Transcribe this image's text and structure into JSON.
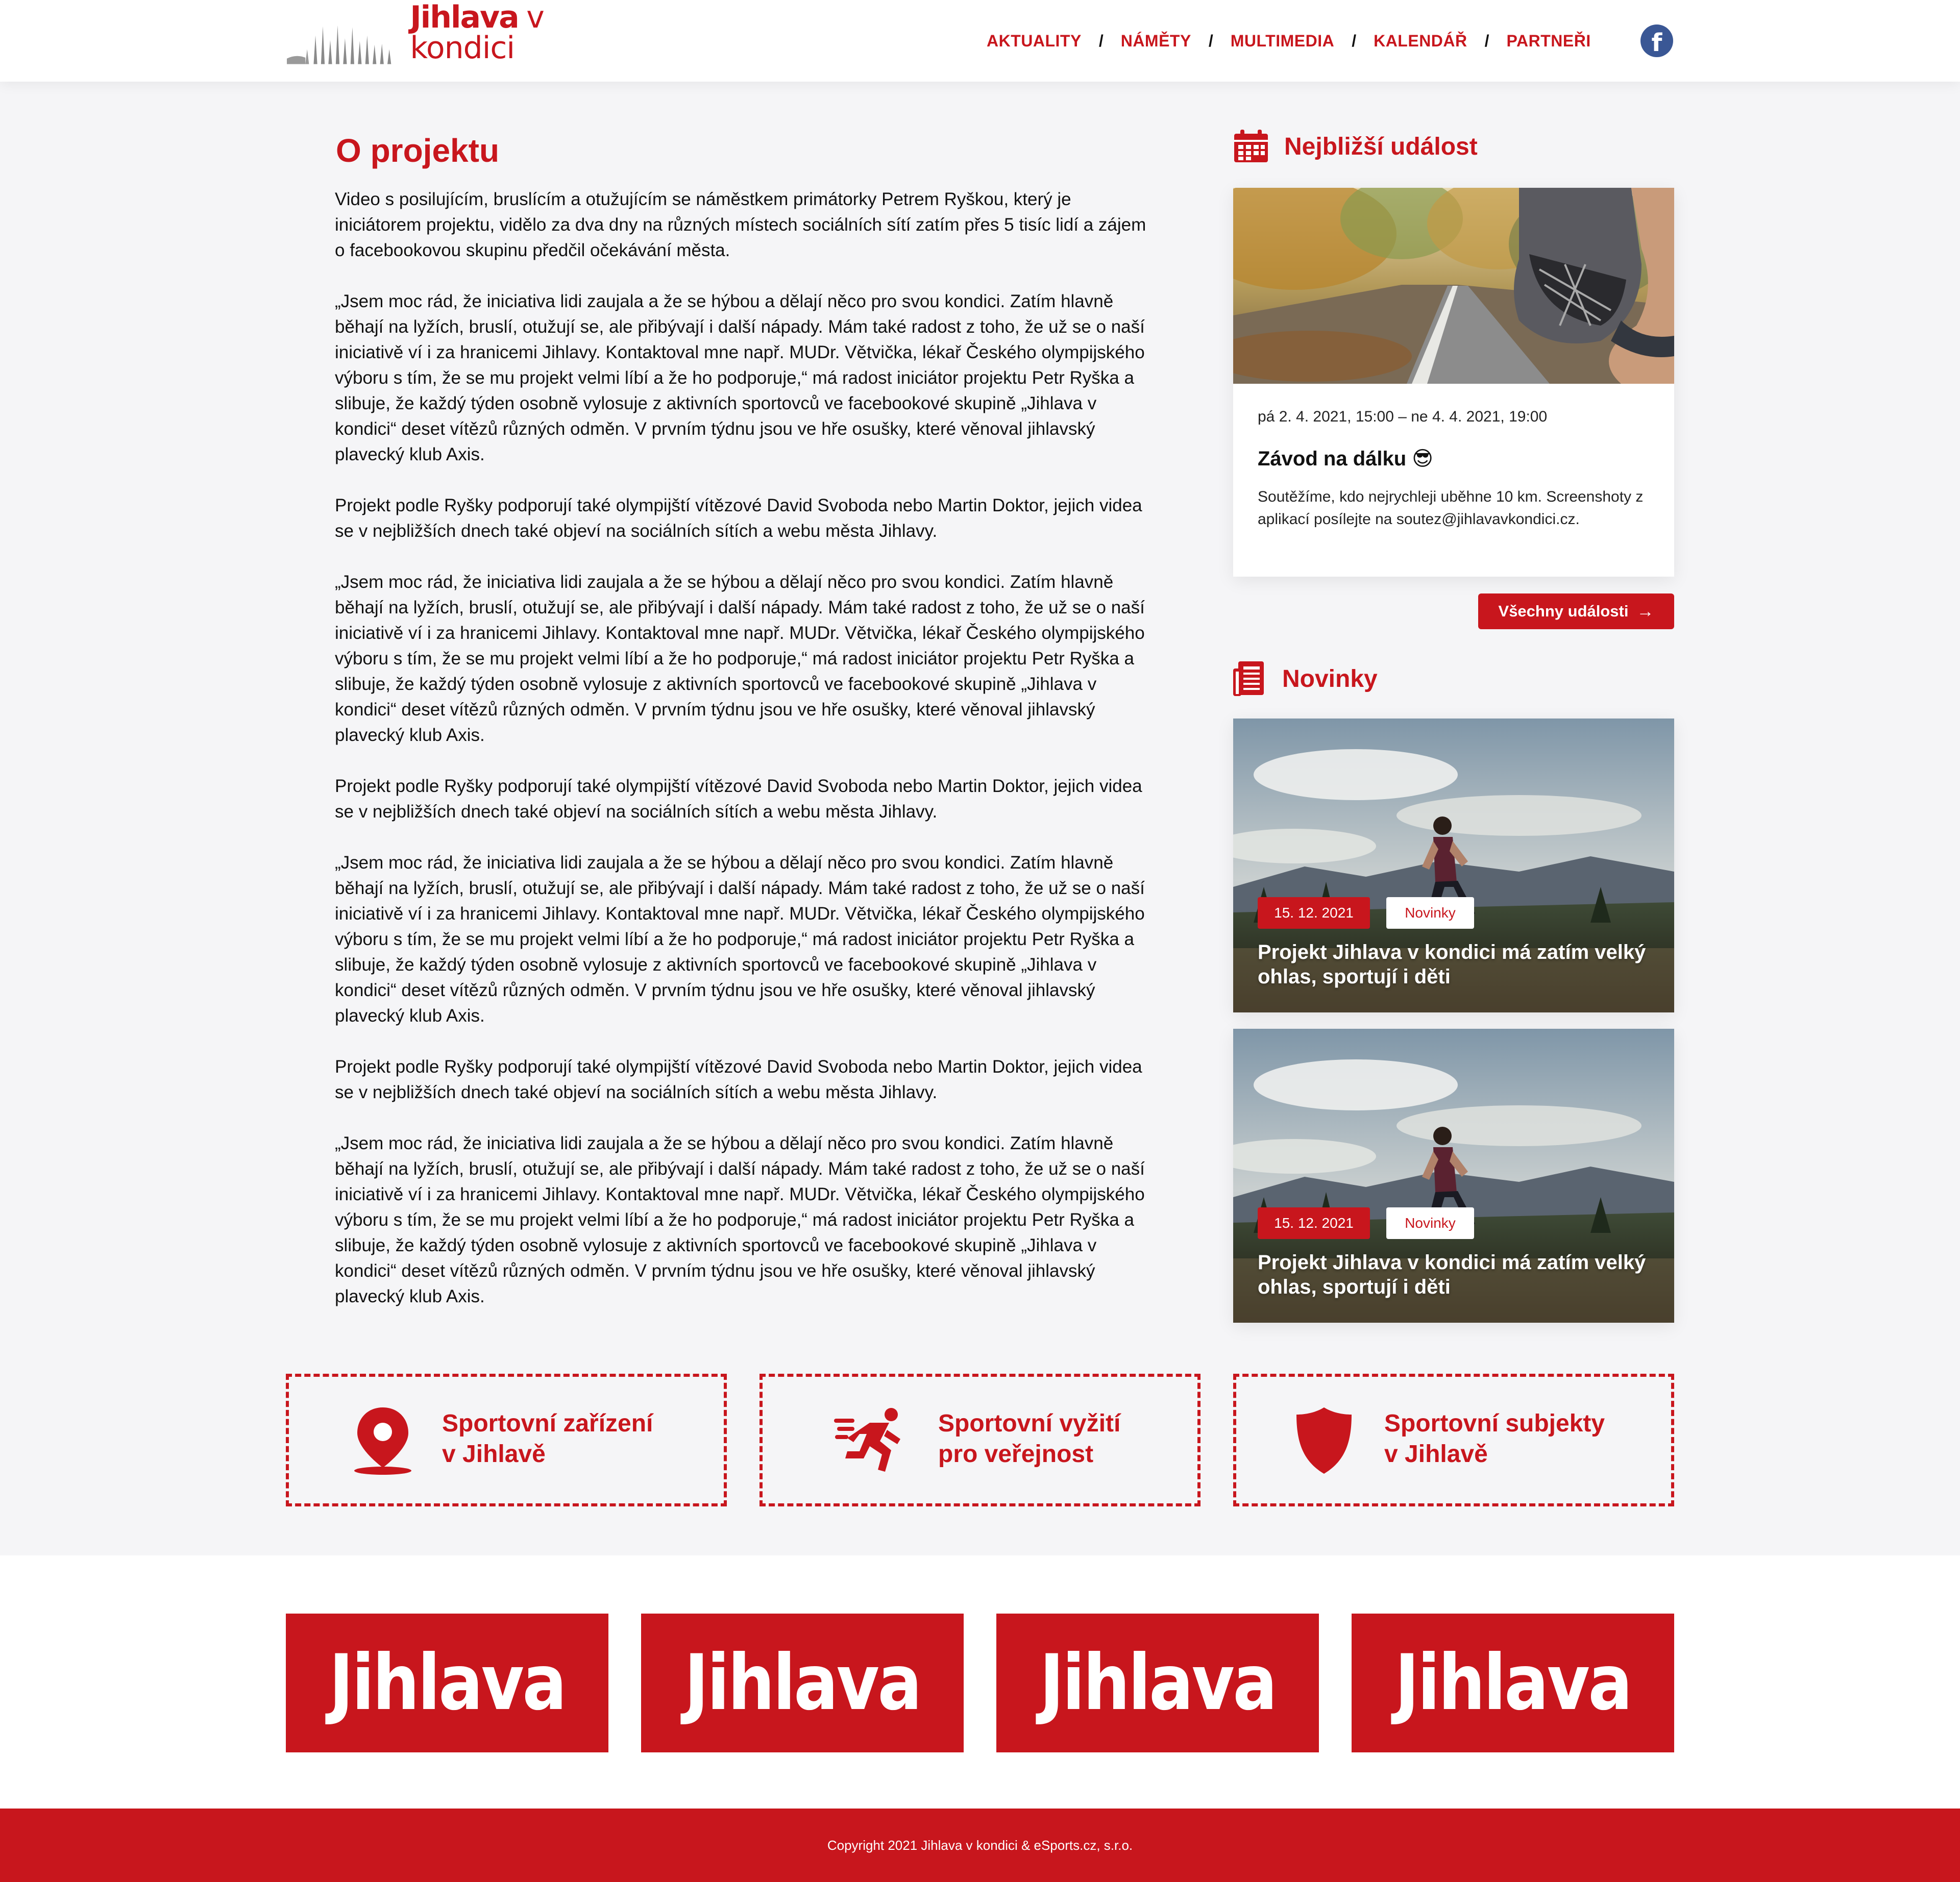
{
  "header": {
    "logo_bold": "Jihlava",
    "logo_light": "v kondici",
    "nav": [
      {
        "label": "AKTUALITY"
      },
      {
        "label": "NÁMĚTY"
      },
      {
        "label": "MULTIMEDIA"
      },
      {
        "label": "KALENDÁŘ"
      },
      {
        "label": "PARTNEŘI"
      }
    ],
    "nav_separator": "/",
    "facebook_icon": "facebook-icon",
    "facebook_glyph": "f"
  },
  "main": {
    "title": "O projektu",
    "paragraphs": [
      "Video s posilujícím, bruslícím a otužujícím se náměstkem primátorky Petrem Ryškou, který je iniciátorem projektu, vidělo za dva dny na různých místech sociálních sítí zatím přes 5 tisíc lidí a zájem o facebookovou skupinu předčil očekávání města.",
      "„Jsem moc rád, že iniciativa lidi zaujala a že se hýbou a dělají něco pro svou kondici. Zatím hlavně běhají na lyžích, bruslí, otužují se, ale přibývají i další nápady. Mám také radost z toho, že už se o naší iniciativě ví i za hranicemi Jihlavy. Kontaktoval mne např. MUDr. Větvička, lékař Českého olympijského výboru s tím, že se mu projekt velmi líbí a že ho podporuje,“ má radost iniciátor projektu Petr Ryška a slibuje, že každý týden osobně vylosuje z aktivních sportovců ve facebookové skupině „Jihlava v kondici“ deset vítězů různých odměn. V prvním týdnu jsou ve hře osušky, které věnoval jihlavský plavecký klub Axis.",
      "Projekt podle Ryšky podporují také olympijští vítězové David Svoboda nebo Martin Doktor, jejich videa se v nejbližších dnech také objeví na sociálních sítích a webu města Jihlavy.",
      "„Jsem moc rád, že iniciativa lidi zaujala a že se hýbou a dělají něco pro svou kondici. Zatím hlavně běhají na lyžích, bruslí, otužují se, ale přibývají i další nápady. Mám také radost z toho, že už se o naší iniciativě ví i za hranicemi Jihlavy. Kontaktoval mne např. MUDr. Větvička, lékař Českého olympijského výboru s tím, že se mu projekt velmi líbí a že ho podporuje,“ má radost iniciátor projektu Petr Ryška a slibuje, že každý týden osobně vylosuje z aktivních sportovců ve facebookové skupině „Jihlava v kondici“ deset vítězů různých odměn. V prvním týdnu jsou ve hře osušky, které věnoval jihlavský plavecký klub Axis.",
      "Projekt podle Ryšky podporují také olympijští vítězové David Svoboda nebo Martin Doktor, jejich videa se v nejbližších dnech také objeví na sociálních sítích a webu města Jihlavy.",
      "„Jsem moc rád, že iniciativa lidi zaujala a že se hýbou a dělají něco pro svou kondici. Zatím hlavně běhají na lyžích, bruslí, otužují se, ale přibývají i další nápady. Mám také radost z toho, že už se o naší iniciativě ví i za hranicemi Jihlavy. Kontaktoval mne např. MUDr. Větvička, lékař Českého olympijského výboru s tím, že se mu projekt velmi líbí a že ho podporuje,“ má radost iniciátor projektu Petr Ryška a slibuje, že každý týden osobně vylosuje z aktivních sportovců ve facebookové skupině „Jihlava v kondici“ deset vítězů různých odměn. V prvním týdnu jsou ve hře osušky, které věnoval jihlavský plavecký klub Axis.",
      "Projekt podle Ryšky podporují také olympijští vítězové David Svoboda nebo Martin Doktor, jejich videa se v nejbližších dnech také objeví na sociálních sítích a webu města Jihlavy.",
      "„Jsem moc rád, že iniciativa lidi zaujala a že se hýbou a dělají něco pro svou kondici. Zatím hlavně běhají na lyžích, bruslí, otužují se, ale přibývají i další nápady. Mám také radost z toho, že už se o naší iniciativě ví i za hranicemi Jihlavy. Kontaktoval mne např. MUDr. Větvička, lékař Českého olympijského výboru s tím, že se mu projekt velmi líbí a že ho podporuje,“ má radost iniciátor projektu Petr Ryška a slibuje, že každý týden osobně vylosuje z aktivních sportovců ve facebookové skupině „Jihlava v kondici“ deset vítězů různých odměn. V prvním týdnu jsou ve hře osušky, které věnoval jihlavský plavecký klub Axis."
    ]
  },
  "sidebar": {
    "event_heading": "Nejbližší událost",
    "event_heading_icon": "calendar-icon",
    "event": {
      "date": "pá 2. 4. 2021, 15:00 – ne 4. 4. 2021, 19:00",
      "title": "Závod na dálku 😎",
      "description": "Soutěžíme, kdo nejrychleji uběhne 10 km. Screenshoty z aplikací posílejte na soutez@jihlavavkondici.cz.",
      "image": "running-shoe-photo"
    },
    "all_events_button": "Všechny události",
    "all_events_arrow": "→",
    "news_heading": "Novinky",
    "news_heading_icon": "newspaper-icon",
    "news": [
      {
        "date": "15. 12. 2021",
        "category": "Novinky",
        "title": "Projekt Jihlava v kondici má zatím velký ohlas, sportují i děti",
        "image": "runner-landscape-photo"
      },
      {
        "date": "15. 12. 2021",
        "category": "Novinky",
        "title": "Projekt Jihlava v kondici má zatím velký ohlas, sportují i děti",
        "image": "runner-landscape-photo"
      }
    ]
  },
  "features": [
    {
      "line1": "Sportovní zařízení",
      "line2": "v Jihlavě",
      "icon": "map-pin-icon"
    },
    {
      "line1": "Sportovní vyžití",
      "line2": "pro veřejnost",
      "icon": "running-person-icon"
    },
    {
      "line1": "Sportovní subjekty",
      "line2": "v Jihlavě",
      "icon": "shield-icon"
    }
  ],
  "partners": [
    {
      "name": "Jihlava"
    },
    {
      "name": "Jihlava"
    },
    {
      "name": "Jihlava"
    },
    {
      "name": "Jihlava"
    }
  ],
  "footer": {
    "copyright": "Copyright 2021 Jihlava v kondici & eSports.cz, s.r.o."
  },
  "colors": {
    "brand_red": "#c8161d",
    "background": "#f5f5f7",
    "facebook_blue": "#3a5795"
  }
}
